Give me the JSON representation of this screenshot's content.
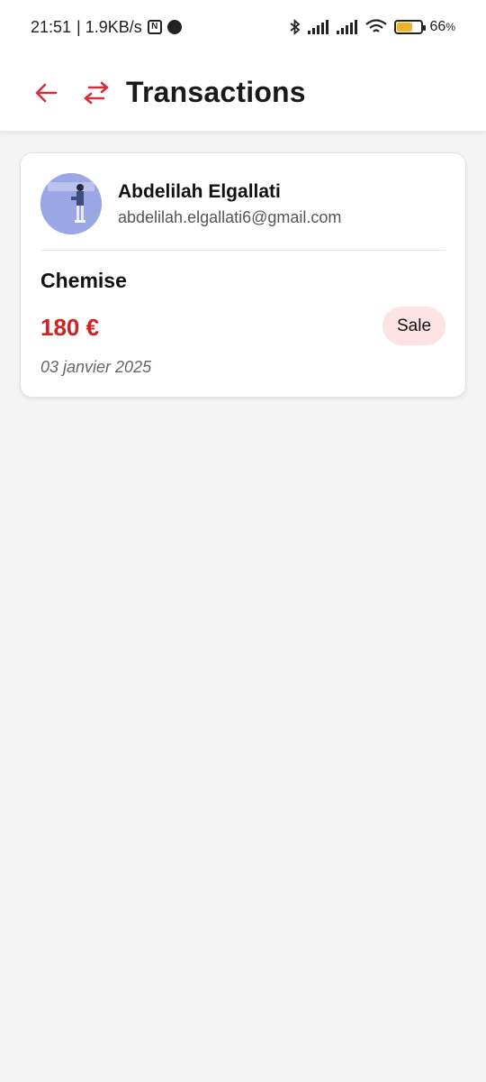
{
  "status_bar": {
    "time": "21:51",
    "speed": "| 1.9KB/s",
    "battery_percent": "66",
    "battery_unit": "%",
    "battery_level": 0.66,
    "icons": [
      "nfc-icon",
      "app-notification-icon",
      "bluetooth-icon",
      "signal-icon",
      "signal-icon",
      "wifi-icon",
      "battery-icon"
    ]
  },
  "app_bar": {
    "title": "Transactions",
    "back_icon": "arrow-left-icon",
    "title_icon": "swap-arrows-icon",
    "accent_color": "#d32f3a"
  },
  "transactions": [
    {
      "user_name": "Abdelilah Elgallati",
      "user_email": "abdelilah.elgallati6@gmail.com",
      "product": "Chemise",
      "price": "180 €",
      "type": "Sale",
      "date": "03 janvier 2025",
      "price_color": "#d21f1f",
      "badge_color": "#fde3e3"
    }
  ]
}
